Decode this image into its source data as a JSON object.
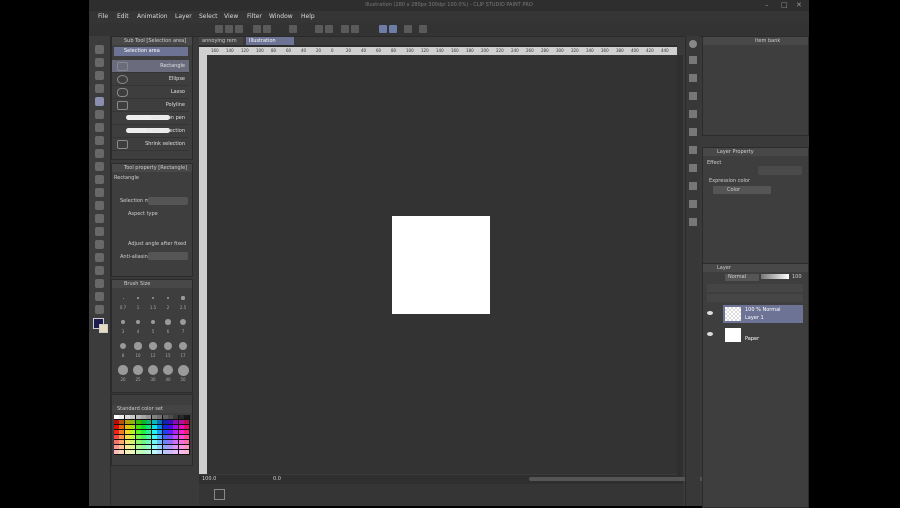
{
  "window": {
    "title": "Illustration (280 x 280px 300dpi 100.0%) - CLIP STUDIO PAINT PRO"
  },
  "menu": [
    "File",
    "Edit",
    "Animation",
    "Layer",
    "Select",
    "View",
    "Filter",
    "Window",
    "Help"
  ],
  "tabs": [
    {
      "label": "annoying rem"
    },
    {
      "label": "Illustration"
    }
  ],
  "subtool_panel": {
    "title": "Sub Tool [Selection area]",
    "group": "Selection area",
    "items": [
      "Rectangle",
      "Ellipse",
      "Lasso",
      "Polyline",
      "Selection pen",
      "Erase selection",
      "Shrink selection"
    ]
  },
  "tool_property": {
    "title": "Tool property [Rectangle]",
    "tool_name": "Rectangle",
    "selection_label": "Selection m",
    "aspect_label": "Aspect type",
    "adjust_label": "Adjust angle after fixed",
    "antialias_label": "Anti-aliasing"
  },
  "brush_size": {
    "title": "Brush Size",
    "sizes": [
      "0.7",
      "1",
      "1.5",
      "2",
      "2.5",
      "3",
      "4",
      "5",
      "6",
      "7",
      "8",
      "10",
      "12",
      "15",
      "17",
      "20",
      "25",
      "30",
      "40",
      "50"
    ]
  },
  "color_set": {
    "title": "Standard color set"
  },
  "ruler_ticks": [
    "160",
    "140",
    "120",
    "100",
    "80",
    "60",
    "40",
    "20",
    "0",
    "20",
    "40",
    "60",
    "80",
    "100",
    "120",
    "140",
    "160",
    "180",
    "200",
    "220",
    "240",
    "260",
    "280",
    "300",
    "320",
    "340",
    "360",
    "380",
    "400",
    "420",
    "440"
  ],
  "status": {
    "zoom": "100.0",
    "angle": "0.0"
  },
  "layer_property": {
    "title": "Layer Property",
    "effect_label": "Effect",
    "expression_label": "Expression color",
    "color_value": "Color"
  },
  "layer_panel": {
    "title": "Layer",
    "blend_mode": "Normal",
    "opacity": "100",
    "layers": [
      {
        "info": "100 % Normal",
        "name": "Layer 1"
      },
      {
        "info": "",
        "name": "Paper"
      }
    ]
  },
  "item_bank": {
    "title": "Item bank"
  }
}
